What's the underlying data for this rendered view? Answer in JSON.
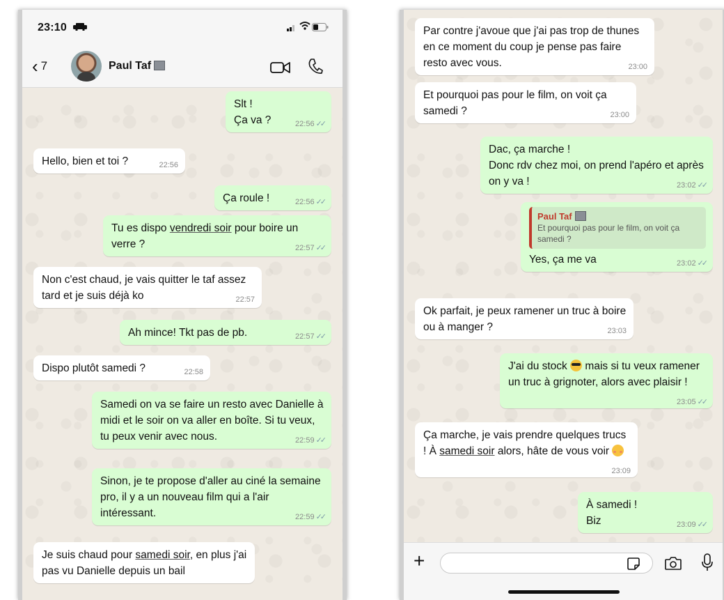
{
  "left": {
    "status_time": "23:10",
    "back_count": "7",
    "contact_name": "Paul Taf",
    "messages": [
      {
        "dir": "out",
        "line1": "Slt !",
        "line2": "Ça va ?",
        "time": "22:56"
      },
      {
        "dir": "in",
        "text": "Hello, bien et toi ?",
        "time": "22:56"
      },
      {
        "dir": "out",
        "text": "Ça roule !",
        "time": "22:56"
      },
      {
        "dir": "out",
        "before": "Tu es dispo ",
        "underline": "vendredi soir",
        "after": " pour boire un verre ?",
        "time": "22:57"
      },
      {
        "dir": "in",
        "text": "Non c'est chaud, je vais quitter le taf assez tard et je suis déjà ko",
        "time": "22:57"
      },
      {
        "dir": "out",
        "text": "Ah mince! Tkt pas de pb.",
        "time": "22:57"
      },
      {
        "dir": "in",
        "text": "Dispo plutôt samedi ?",
        "time": "22:58"
      },
      {
        "dir": "out",
        "text": "Samedi on va se faire un resto avec Danielle à midi et le soir on va aller en boîte. Si tu veux, tu peux venir avec nous.",
        "time": "22:59"
      },
      {
        "dir": "out",
        "text": "Sinon, je te propose d'aller au ciné la semaine pro, il y a un nouveau film qui a l'air intéressant.",
        "time": "22:59"
      },
      {
        "dir": "in",
        "before": "Je suis chaud pour ",
        "underline": "samedi soir",
        "after": ", en plus j'ai pas vu Danielle depuis un bail"
      }
    ]
  },
  "right": {
    "messages": [
      {
        "dir": "in",
        "text": "Par contre j'avoue que j'ai pas trop de thunes en ce moment du coup je pense pas faire resto avec vous.",
        "time": "23:00"
      },
      {
        "dir": "in",
        "text": "Et pourquoi pas pour le film, on voit ça samedi ?",
        "time": "23:00"
      },
      {
        "dir": "out",
        "line1": "Dac, ça marche !",
        "line2": "Donc rdv chez moi, on prend l'apéro et après on y va !",
        "time": "23:02"
      },
      {
        "dir": "out",
        "quote_name": "Paul Taf",
        "quote_text": "Et pourquoi pas pour le film, on voit ça samedi ?",
        "text": "Yes, ça me va",
        "time": "23:02"
      },
      {
        "dir": "in",
        "text": "Ok parfait, je peux ramener un truc à boire ou à manger ?",
        "time": "23:03"
      },
      {
        "dir": "out",
        "before": "J'ai du stock",
        "after": " mais si tu veux ramener un truc à grignoter, alors avec plaisir !",
        "time": "23:05"
      },
      {
        "dir": "in",
        "before": "Ça marche, je vais prendre quelques trucs ! À ",
        "underline": "samedi soir",
        "after": " alors, hâte de vous voir",
        "time": "23:09"
      },
      {
        "dir": "out",
        "line1": "À samedi !",
        "line2": "Biz",
        "time": "23:09"
      }
    ],
    "input_value": ""
  },
  "icons": {
    "car": "car-icon",
    "signal": "signal-icon",
    "wifi": "wifi-icon",
    "battery": "battery-icon",
    "back": "chevron-left-icon",
    "video": "video-camera-icon",
    "call": "phone-icon",
    "plus": "plus-icon",
    "sticker": "sticker-icon",
    "camera": "camera-icon",
    "mic": "microphone-icon",
    "emoji_1": "sunglasses-emoji",
    "emoji_2": "blushing-face-emoji"
  },
  "colors": {
    "outgoing_bubble": "#d9fdd3",
    "incoming_bubble": "#ffffff",
    "chat_background": "#efeae2",
    "reply_accent": "#c0392b",
    "read_tick": "#7d9aa8"
  }
}
